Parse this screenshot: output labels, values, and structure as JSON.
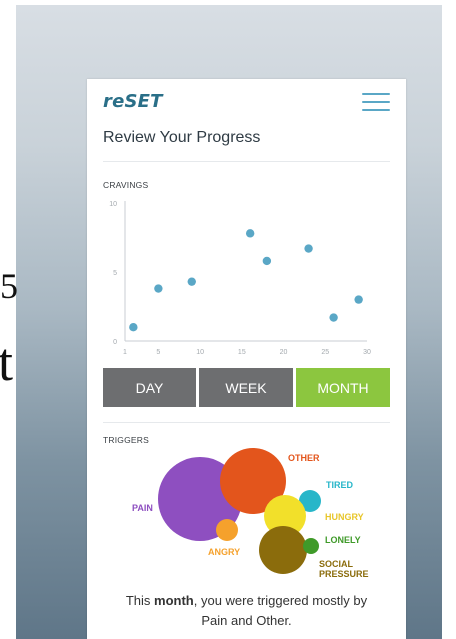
{
  "background_chars": [
    "5",
    "t"
  ],
  "app": {
    "logo": "reSET",
    "menu_icon": "hamburger-menu-icon",
    "accent_color": "#5aa7c6"
  },
  "page": {
    "title": "Review Your Progress"
  },
  "cravings": {
    "label": "CRAVINGS"
  },
  "chart_data": {
    "type": "scatter",
    "title": "CRAVINGS",
    "x_ticks": [
      "1",
      "5",
      "10",
      "15",
      "20",
      "25",
      "30"
    ],
    "y_ticks": [
      "0",
      "5",
      "10"
    ],
    "xlim": [
      1,
      30
    ],
    "ylim": [
      0,
      10
    ],
    "point_color": "#5aa7c6",
    "points": [
      {
        "x": 2,
        "y": 1.0
      },
      {
        "x": 5,
        "y": 3.8
      },
      {
        "x": 9,
        "y": 4.3
      },
      {
        "x": 16,
        "y": 7.8
      },
      {
        "x": 18,
        "y": 5.8
      },
      {
        "x": 23,
        "y": 6.7
      },
      {
        "x": 26,
        "y": 1.7
      },
      {
        "x": 29,
        "y": 3.0
      }
    ]
  },
  "range_tabs": {
    "items": [
      {
        "label": "DAY",
        "color": "#6d6e70",
        "active": false
      },
      {
        "label": "WEEK",
        "color": "#6d6e70",
        "active": false
      },
      {
        "label": "MONTH",
        "color": "#8cc63f",
        "active": true
      }
    ]
  },
  "triggers": {
    "label": "TRIGGERS",
    "items": [
      {
        "name": "PAIN",
        "color": "#8e4fc0"
      },
      {
        "name": "OTHER",
        "color": "#e3551c"
      },
      {
        "name": "TIRED",
        "color": "#27b6c9"
      },
      {
        "name": "HUNGRY",
        "color": "#f2e02a"
      },
      {
        "name": "ANGRY",
        "color": "#f5a12c"
      },
      {
        "name": "LONELY",
        "color": "#3f9a29"
      },
      {
        "name": "SOCIAL PRESSURE",
        "color": "#8b6c0c"
      }
    ]
  },
  "summary": {
    "prefix": "This ",
    "period": "month",
    "middle": ", you were triggered mostly by",
    "line2": "Pain and Other."
  }
}
